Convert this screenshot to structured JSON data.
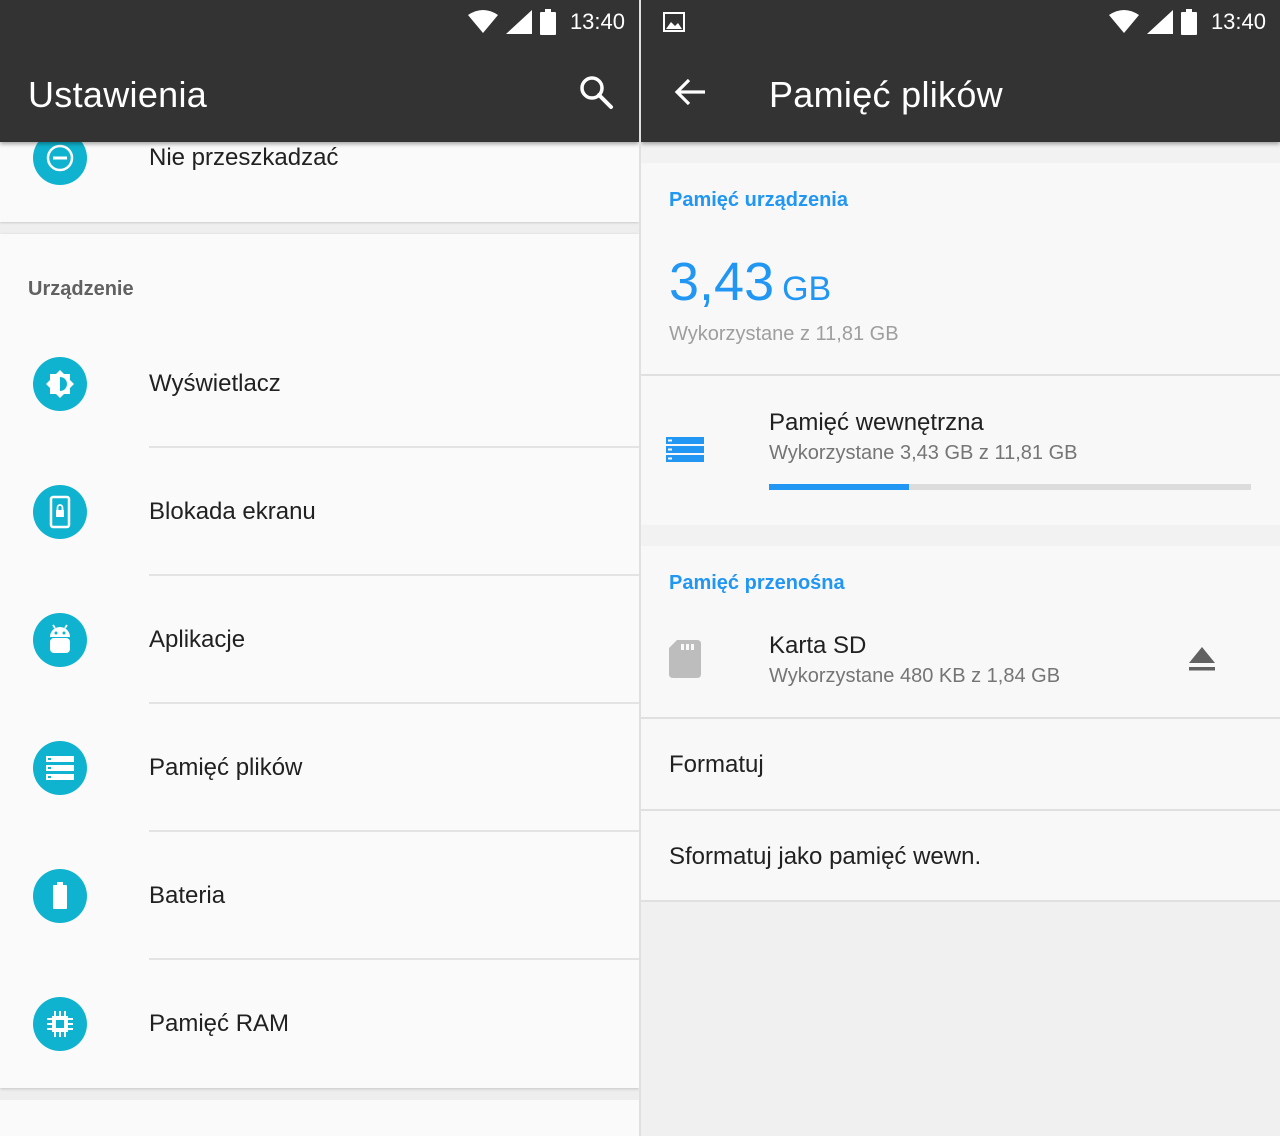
{
  "status": {
    "time": "13:40"
  },
  "left": {
    "title": "Ustawienia",
    "top_item": {
      "label": "Nie przeszkadzać",
      "icon": "do-not-disturb-icon"
    },
    "section_header": "Urządzenie",
    "items": [
      {
        "label": "Wyświetlacz",
        "icon": "brightness-icon"
      },
      {
        "label": "Blokada ekranu",
        "icon": "lock-screen-icon"
      },
      {
        "label": "Aplikacje",
        "icon": "android-icon"
      },
      {
        "label": "Pamięć plików",
        "icon": "storage-icon"
      },
      {
        "label": "Bateria",
        "icon": "battery-icon"
      },
      {
        "label": "Pamięć RAM",
        "icon": "memory-icon"
      }
    ]
  },
  "right": {
    "title": "Pamięć plików",
    "device_header": "Pamięć urządzenia",
    "used_amount": "3,43",
    "used_unit": "GB",
    "used_of": "Wykorzystane z 11,81 GB",
    "internal": {
      "title": "Pamięć wewnętrzna",
      "subtitle": "Wykorzystane 3,43 GB z 11,81 GB",
      "used_fraction": 0.29
    },
    "portable_header": "Pamięć przenośna",
    "sd": {
      "title": "Karta SD",
      "subtitle": "Wykorzystane 480 KB z 1,84 GB"
    },
    "format_label": "Formatuj",
    "format_internal_label": "Sformatuj jako pamięć wewn."
  },
  "colors": {
    "accent": "#2196f3",
    "icon_circle": "#0fb3d0",
    "appbar": "#333333"
  }
}
